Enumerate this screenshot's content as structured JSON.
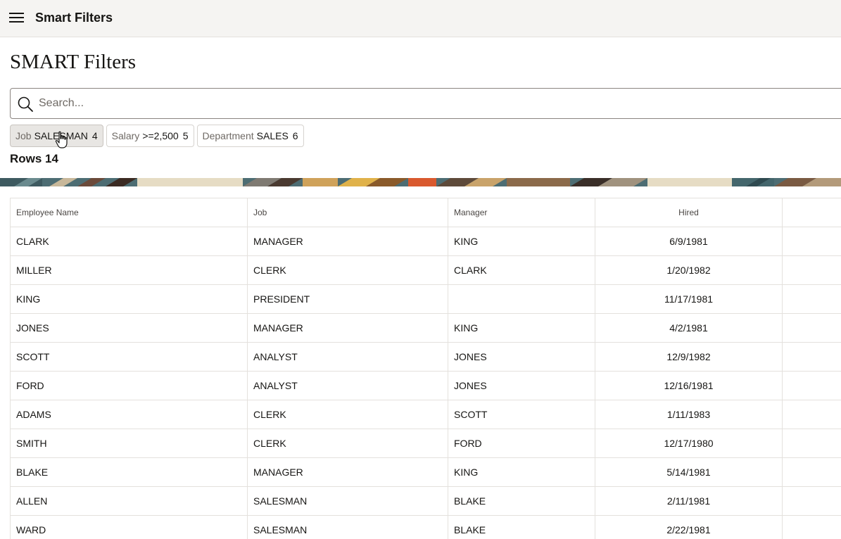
{
  "app": {
    "title": "Smart Filters",
    "menu_icon": "hamburger-menu-icon"
  },
  "page": {
    "title": "SMART Filters"
  },
  "search": {
    "placeholder": "Search...",
    "value": "",
    "icon": "search-icon"
  },
  "filters": [
    {
      "key": "Job",
      "value": "SALESMAN",
      "count": "4",
      "active": true
    },
    {
      "key": "Salary",
      "value": ">=2,500",
      "count": "5",
      "active": false
    },
    {
      "key": "Department",
      "value": "SALES",
      "count": "6",
      "active": false
    }
  ],
  "rows_label": "Rows 14",
  "table": {
    "columns": [
      "Employee Name",
      "Job",
      "Manager",
      "Hired",
      ""
    ],
    "rows": [
      [
        "CLARK",
        "MANAGER",
        "KING",
        "6/9/1981"
      ],
      [
        "MILLER",
        "CLERK",
        "CLARK",
        "1/20/1982"
      ],
      [
        "KING",
        "PRESIDENT",
        "",
        "11/17/1981"
      ],
      [
        "JONES",
        "MANAGER",
        "KING",
        "4/2/1981"
      ],
      [
        "SCOTT",
        "ANALYST",
        "JONES",
        "12/9/1982"
      ],
      [
        "FORD",
        "ANALYST",
        "JONES",
        "12/16/1981"
      ],
      [
        "ADAMS",
        "CLERK",
        "SCOTT",
        "1/11/1983"
      ],
      [
        "SMITH",
        "CLERK",
        "FORD",
        "12/17/1980"
      ],
      [
        "BLAKE",
        "MANAGER",
        "KING",
        "5/14/1981"
      ],
      [
        "ALLEN",
        "SALESMAN",
        "BLAKE",
        "2/11/1981"
      ],
      [
        "WARD",
        "SALESMAN",
        "BLAKE",
        "2/22/1981"
      ]
    ]
  },
  "colors": {
    "header_bg": "#f5f4f2",
    "border": "#e4e1dd",
    "text": "#161513",
    "muted": "#6f6a65"
  }
}
